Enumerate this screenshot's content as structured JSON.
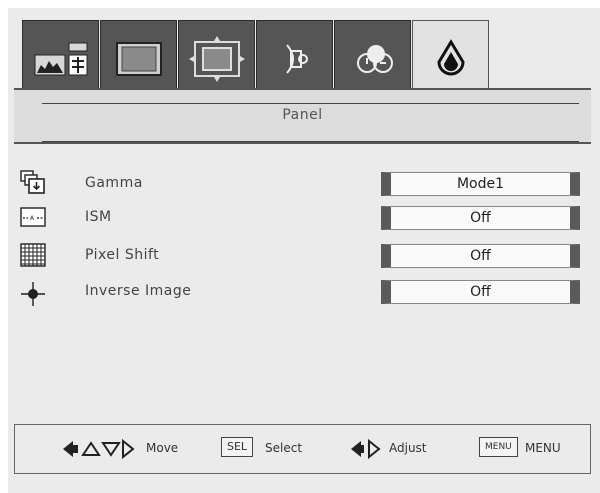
{
  "tabs": [
    {
      "icon": "image-settings-icon",
      "active": false
    },
    {
      "icon": "display-icon",
      "active": false
    },
    {
      "icon": "setup-icon",
      "active": false
    },
    {
      "icon": "audio-icon",
      "active": false
    },
    {
      "icon": "options-icon",
      "active": false
    },
    {
      "icon": "panel-icon",
      "active": true
    }
  ],
  "header": {
    "title": "Panel"
  },
  "items": [
    {
      "label": "Gamma",
      "value": "Mode1",
      "icon": "gamma-icon"
    },
    {
      "label": "ISM",
      "value": "Off",
      "icon": "ism-icon"
    },
    {
      "label": "Pixel Shift",
      "value": "Off",
      "icon": "pixel-shift-icon"
    },
    {
      "label": "Inverse Image",
      "value": "Off",
      "icon": "inverse-image-icon"
    }
  ],
  "footer": {
    "move_label": "Move",
    "sel_key": "SEL",
    "select_label": "Select",
    "adjust_label": "Adjust",
    "menu_key": "MENU",
    "menu_label": "MENU"
  }
}
